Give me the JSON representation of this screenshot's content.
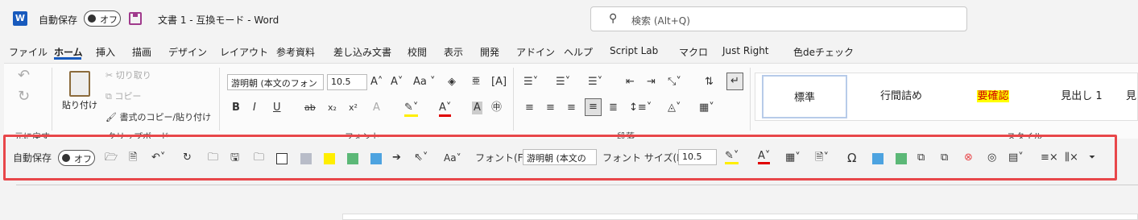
{
  "titlebar": {
    "logo": "W",
    "autosave_label": "自動保存",
    "toggle_state": "オフ",
    "doc_title": "文書 1 - 互換モード - Word",
    "search_placeholder": "検索 (Alt+Q)"
  },
  "menu": {
    "items": [
      "ファイル",
      "ホーム",
      "挿入",
      "描画",
      "デザイン",
      "レイアウト",
      "参考資料",
      "差し込み文書",
      "校閲",
      "表示",
      "開発",
      "アドイン",
      "ヘルプ",
      "Script Lab",
      "マクロ",
      "Just Right",
      "色deチェック"
    ],
    "active": "ホーム"
  },
  "ribbon": {
    "undo_icon": "↶",
    "redo_icon": "↻",
    "paste_label": "貼り付け",
    "cut_label": "切り取り",
    "copy_label": "コピー",
    "format_painter_label": "書式のコピー/貼り付け",
    "font_name": "游明朝 (本文のフォン",
    "font_size": "10.5",
    "aa_label": "Aa",
    "bold": "B",
    "italic": "I",
    "underline": "U",
    "strike": "ab",
    "sub": "x₂",
    "sup": "x²",
    "font_a": "A",
    "styles": [
      "標準",
      "行間詰め",
      "要確認",
      "見出し 1",
      "見"
    ],
    "group_labels": [
      "元に戻す",
      "クリップボード",
      "フォント",
      "段落",
      "スタイル"
    ]
  },
  "qat": {
    "autosave_label": "自動保存",
    "toggle_state": "オフ",
    "font_label": "フォント(F):",
    "font_value": "游明朝 (本文の",
    "size_label": "フォント サイズ(F):",
    "size_value": "10.5",
    "aa_label": "Aa",
    "colors": {
      "gray": "#b8bcc8",
      "yellow": "#ffee00",
      "green": "#5cb877",
      "blue": "#4da3e0",
      "red": "#e8474a"
    }
  }
}
